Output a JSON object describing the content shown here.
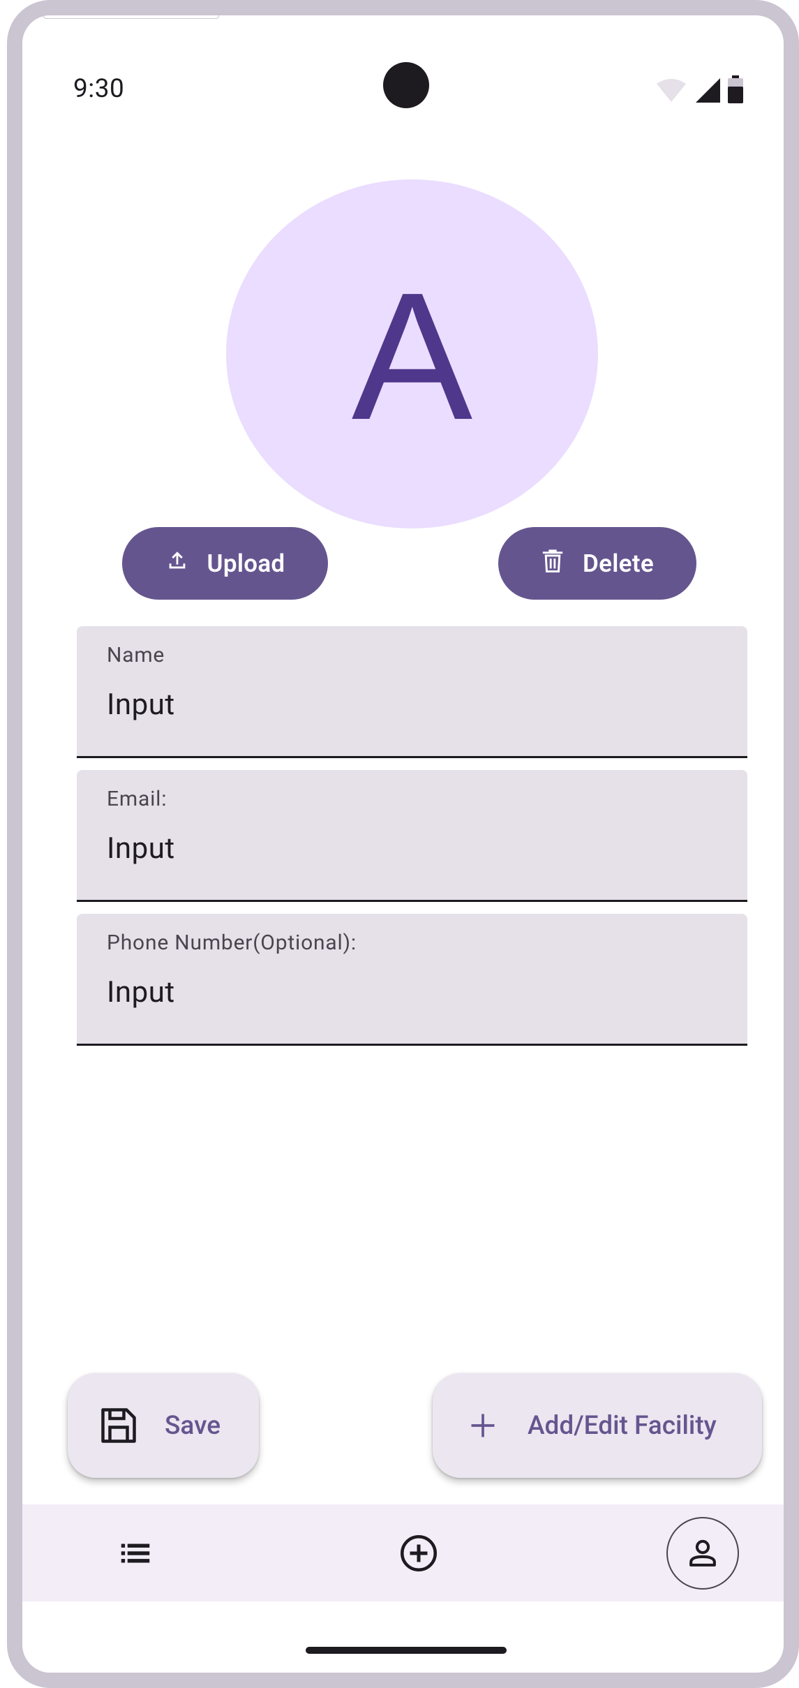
{
  "status_bar": {
    "time": "9:30",
    "icons": [
      "wifi-icon",
      "cell-signal-icon",
      "battery-icon"
    ]
  },
  "avatar": {
    "letter": "A",
    "background": "#eaddff",
    "letter_color": "#4f378b"
  },
  "photo_actions": {
    "upload_label": "Upload",
    "upload_icon": "upload-icon",
    "delete_label": "Delete",
    "delete_icon": "trash-icon",
    "button_color": "#65558f"
  },
  "form": {
    "fields": [
      {
        "label": "Name",
        "value": "Input"
      },
      {
        "label": "Email:",
        "value": "Input"
      },
      {
        "label": "Phone Number(Optional):",
        "value": "Input"
      }
    ]
  },
  "fabs": {
    "save_label": "Save",
    "save_icon": "save-icon",
    "add_facility_label": "Add/Edit Facility",
    "add_facility_icon": "plus-icon"
  },
  "bottom_nav": {
    "items": [
      {
        "icon": "list-icon"
      },
      {
        "icon": "add-circle-icon"
      },
      {
        "icon": "profile-icon",
        "selected": true
      }
    ]
  }
}
